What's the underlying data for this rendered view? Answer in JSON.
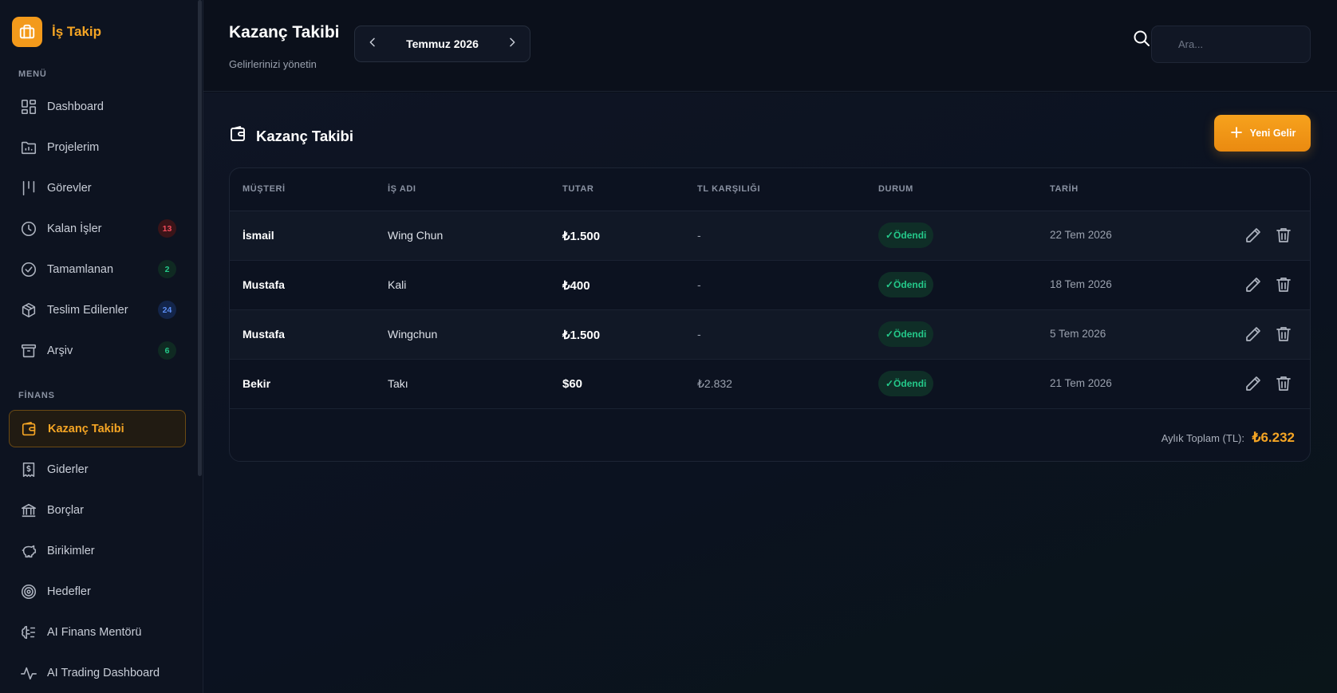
{
  "brand": {
    "name": "İş Takip"
  },
  "sidebar": {
    "menu_label": "MENÜ",
    "finance_label": "FİNANS",
    "menu_items": [
      {
        "label": "Dashboard"
      },
      {
        "label": "Projelerim"
      },
      {
        "label": "Görevler"
      },
      {
        "label": "Kalan İşler",
        "badge": "13"
      },
      {
        "label": "Tamamlanan",
        "badge": "2"
      },
      {
        "label": "Teslim Edilenler",
        "badge": "24"
      },
      {
        "label": "Arşiv",
        "badge": "6"
      }
    ],
    "finance_items": [
      {
        "label": "Kazanç Takibi",
        "active": true
      },
      {
        "label": "Giderler"
      },
      {
        "label": "Borçlar"
      },
      {
        "label": "Birikimler"
      },
      {
        "label": "Hedefler"
      },
      {
        "label": "AI Finans Mentörü"
      },
      {
        "label": "AI Trading Dashboard"
      }
    ]
  },
  "header": {
    "title": "Kazanç Takibi",
    "subtitle": "Gelirlerinizi yönetin",
    "month": "Temmuz 2026",
    "search_placeholder": "Ara..."
  },
  "main": {
    "section_title": "Kazanç Takibi",
    "new_button": "Yeni Gelir",
    "columns": [
      "MÜŞTERİ",
      "İŞ ADI",
      "TUTAR",
      "TL KARŞILIĞI",
      "DURUM",
      "TARİH"
    ],
    "rows": [
      {
        "customer": "İsmail",
        "job": "Wing Chun",
        "amount": "₺1.500",
        "tl": "-",
        "status": "✓Ödendi",
        "date": "22 Tem 2026"
      },
      {
        "customer": "Mustafa",
        "job": "Kali",
        "amount": "₺400",
        "tl": "-",
        "status": "✓Ödendi",
        "date": "18 Tem 2026"
      },
      {
        "customer": "Mustafa",
        "job": "Wingchun",
        "amount": "₺1.500",
        "tl": "-",
        "status": "✓Ödendi",
        "date": "5 Tem 2026"
      },
      {
        "customer": "Bekir",
        "job": "Takı",
        "amount": "$60",
        "tl": "₺2.832",
        "status": "✓Ödendi",
        "date": "21 Tem 2026"
      }
    ],
    "total_label": "Aylık Toplam (TL):",
    "total_value": "₺6.232"
  },
  "colors": {
    "accent": "#f5a524",
    "success": "#24c98a",
    "danger": "#ef4b5b",
    "info": "#5b8df2",
    "bg": "#0a0f1a"
  }
}
